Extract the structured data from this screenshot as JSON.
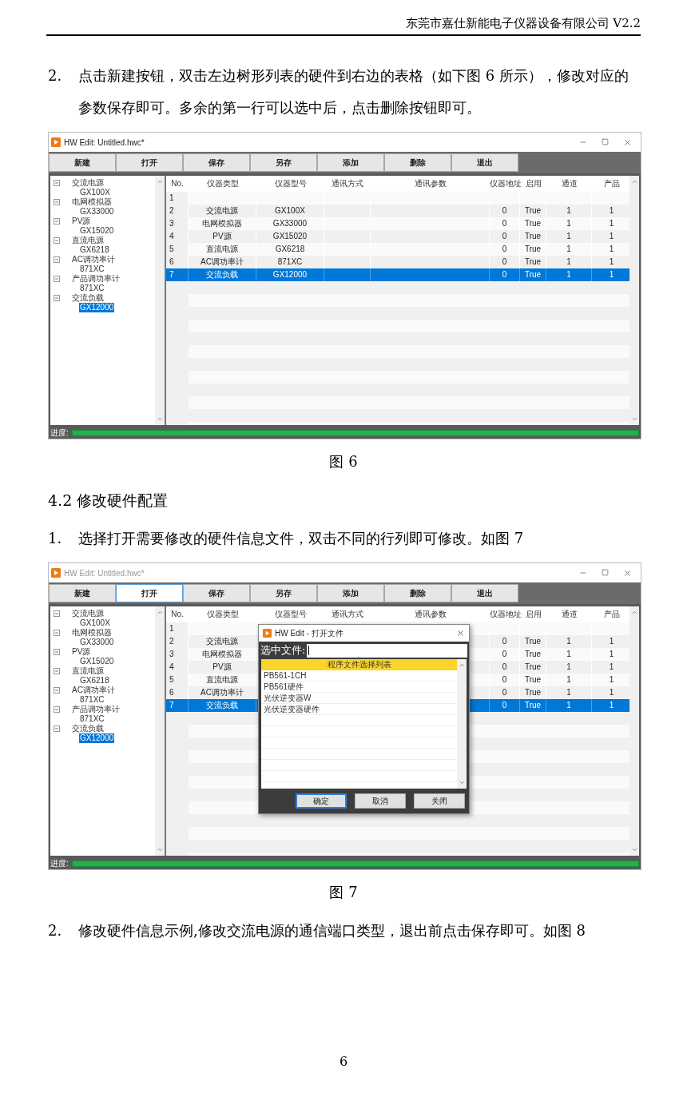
{
  "header": "东莞市嘉仕新能电子仪器设备有限公司 V2.2",
  "blocks": [
    {
      "kind": "step",
      "number": "2.",
      "text": "点击新建按钮，双击左边树形列表的硬件到右边的表格（如下图 6 所示），修改对应的参数保存即可。多余的第一行可以选中后，点击删除按钮即可。"
    },
    {
      "kind": "window",
      "title": "HW Edit: Untitled.hwc*",
      "active": true,
      "toolbar": [
        {
          "label": "新建",
          "selected": false
        },
        {
          "label": "打开",
          "selected": false
        },
        {
          "label": "保存",
          "selected": false
        },
        {
          "label": "另存",
          "selected": false
        },
        {
          "label": "添加",
          "selected": false
        },
        {
          "label": "删除",
          "selected": false
        },
        {
          "label": "退出",
          "selected": false
        }
      ],
      "tree": [
        {
          "label": "交流电源",
          "expanded": true,
          "children": [
            {
              "label": "GX100X",
              "selected": false
            }
          ]
        },
        {
          "label": "电网模拟器",
          "expanded": true,
          "children": [
            {
              "label": "GX33000",
              "selected": false
            }
          ]
        },
        {
          "label": "PV源",
          "expanded": true,
          "children": [
            {
              "label": "GX15020",
              "selected": false
            }
          ]
        },
        {
          "label": "直流电源",
          "expanded": true,
          "children": [
            {
              "label": "GX6218",
              "selected": false
            }
          ]
        },
        {
          "label": "AC调功率计",
          "expanded": true,
          "children": [
            {
              "label": "871XC",
              "selected": false
            }
          ]
        },
        {
          "label": "产品调功率计",
          "expanded": true,
          "children": [
            {
              "label": "871XC",
              "selected": false
            }
          ]
        },
        {
          "label": "交流负载",
          "expanded": true,
          "children": [
            {
              "label": "GX12000",
              "selected": true
            }
          ]
        }
      ],
      "table": {
        "columns": [
          "No.",
          "仪器类型",
          "仪器型号",
          "通讯方式",
          "通讯参数",
          "仪器地址",
          "启用",
          "通道",
          "产品"
        ],
        "rows": [
          {
            "no": "1",
            "selected": false
          },
          {
            "no": "2",
            "type": "交流电源",
            "model": "GX100X",
            "address": "0",
            "enabled": "True",
            "channel": "1",
            "product": "1",
            "selected": false
          },
          {
            "no": "3",
            "type": "电网模拟器",
            "model": "GX33000",
            "address": "0",
            "enabled": "True",
            "channel": "1",
            "product": "1",
            "selected": false
          },
          {
            "no": "4",
            "type": "PV源",
            "model": "GX15020",
            "address": "0",
            "enabled": "True",
            "channel": "1",
            "product": "1",
            "selected": false
          },
          {
            "no": "5",
            "type": "直流电源",
            "model": "GX6218",
            "address": "0",
            "enabled": "True",
            "channel": "1",
            "product": "1",
            "selected": false
          },
          {
            "no": "6",
            "type": "AC调功率计",
            "model": "871XC",
            "address": "0",
            "enabled": "True",
            "channel": "1",
            "product": "1",
            "selected": false
          },
          {
            "no": "7",
            "type": "交流负载",
            "model": "GX12000",
            "address": "0",
            "enabled": "True",
            "channel": "1",
            "product": "1",
            "selected": true
          }
        ]
      },
      "status": {
        "label": "进度:",
        "level": 1
      }
    },
    {
      "kind": "caption",
      "text": "图 6"
    },
    {
      "kind": "heading",
      "text": "4.2 修改硬件配置"
    },
    {
      "kind": "step",
      "number": "1.",
      "text": "选择打开需要修改的硬件信息文件，双击不同的行列即可修改。如图 7"
    },
    {
      "kind": "window",
      "title": "HW Edit: Untitled.hwc*",
      "active": false,
      "toolbar": [
        {
          "label": "新建",
          "selected": false
        },
        {
          "label": "打开",
          "selected": true
        },
        {
          "label": "保存",
          "selected": false
        },
        {
          "label": "另存",
          "selected": false
        },
        {
          "label": "添加",
          "selected": false
        },
        {
          "label": "删除",
          "selected": false
        },
        {
          "label": "退出",
          "selected": false
        }
      ],
      "tree": [
        {
          "label": "交流电源",
          "expanded": true,
          "children": [
            {
              "label": "GX100X",
              "selected": false
            }
          ]
        },
        {
          "label": "电网模拟器",
          "expanded": true,
          "children": [
            {
              "label": "GX33000",
              "selected": false
            }
          ]
        },
        {
          "label": "PV源",
          "expanded": true,
          "children": [
            {
              "label": "GX15020",
              "selected": false
            }
          ]
        },
        {
          "label": "直流电源",
          "expanded": true,
          "children": [
            {
              "label": "GX6218",
              "selected": false
            }
          ]
        },
        {
          "label": "AC调功率计",
          "expanded": true,
          "children": [
            {
              "label": "871XC",
              "selected": false
            }
          ]
        },
        {
          "label": "产品调功率计",
          "expanded": true,
          "children": [
            {
              "label": "871XC",
              "selected": false
            }
          ]
        },
        {
          "label": "交流负载",
          "expanded": true,
          "children": [
            {
              "label": "GX12000",
              "selected": true
            }
          ]
        }
      ],
      "table": {
        "columns": [
          "No.",
          "仪器类型",
          "仪器型号",
          "通讯方式",
          "通讯参数",
          "仪器地址",
          "启用",
          "通道",
          "产品"
        ],
        "rows": [
          {
            "no": "1",
            "selected": false
          },
          {
            "no": "2",
            "type": "交流电源",
            "address": "0",
            "enabled": "True",
            "channel": "1",
            "product": "1",
            "selected": false
          },
          {
            "no": "3",
            "type": "电网模拟器",
            "address": "0",
            "enabled": "True",
            "channel": "1",
            "product": "1",
            "selected": false
          },
          {
            "no": "4",
            "type": "PV源",
            "address": "0",
            "enabled": "True",
            "channel": "1",
            "product": "1",
            "selected": false
          },
          {
            "no": "5",
            "type": "直流电源",
            "address": "0",
            "enabled": "True",
            "channel": "1",
            "product": "1",
            "selected": false
          },
          {
            "no": "6",
            "type": "AC调功率计",
            "address": "0",
            "enabled": "True",
            "channel": "1",
            "product": "1",
            "selected": false
          },
          {
            "no": "7",
            "type": "交流负载",
            "address": "0",
            "enabled": "True",
            "channel": "1",
            "product": "1",
            "selected": true
          }
        ]
      },
      "status": {
        "label": "进度:",
        "level": 1
      },
      "dialog": {
        "title": "HW Edit - 打开文件",
        "field_label": "选中文件:",
        "list_header": "程序文件选择列表",
        "items": [
          "PB561-1CH",
          "PB561硬件",
          "光伏逆变器W",
          "光伏逆变器硬件"
        ],
        "buttons": [
          {
            "label": "确定",
            "selected": true
          },
          {
            "label": "取消",
            "selected": false
          },
          {
            "label": "关闭",
            "selected": false
          }
        ]
      }
    },
    {
      "kind": "caption",
      "text": "图 7"
    },
    {
      "kind": "step",
      "number": "2.",
      "text": "修改硬件信息示例,修改交流电源的通信端口类型，退出前点击保存即可。如图 8"
    }
  ],
  "page_number": "6"
}
